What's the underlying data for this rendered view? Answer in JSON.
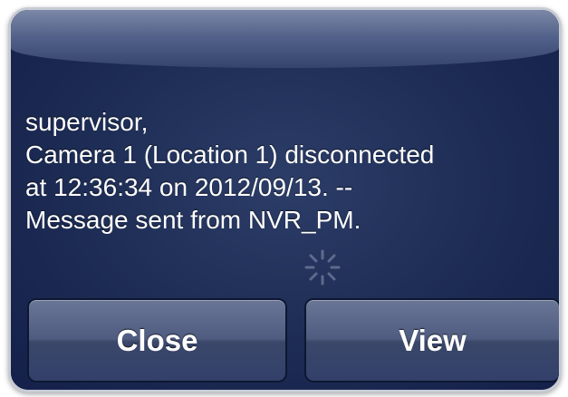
{
  "alert": {
    "message_lines": [
      "supervisor,",
      "Camera 1 (Location 1) disconnected",
      "at 12:36:34 on 2012/09/13. --",
      "Message sent from NVR_PM."
    ],
    "buttons": {
      "close_label": "Close",
      "view_label": "View"
    }
  },
  "icons": {
    "loading": "activity-spinner-icon"
  },
  "colors": {
    "alert_background": "#1b2a4e",
    "button_gradient_top": "#6a7696",
    "text": "#ffffff"
  }
}
